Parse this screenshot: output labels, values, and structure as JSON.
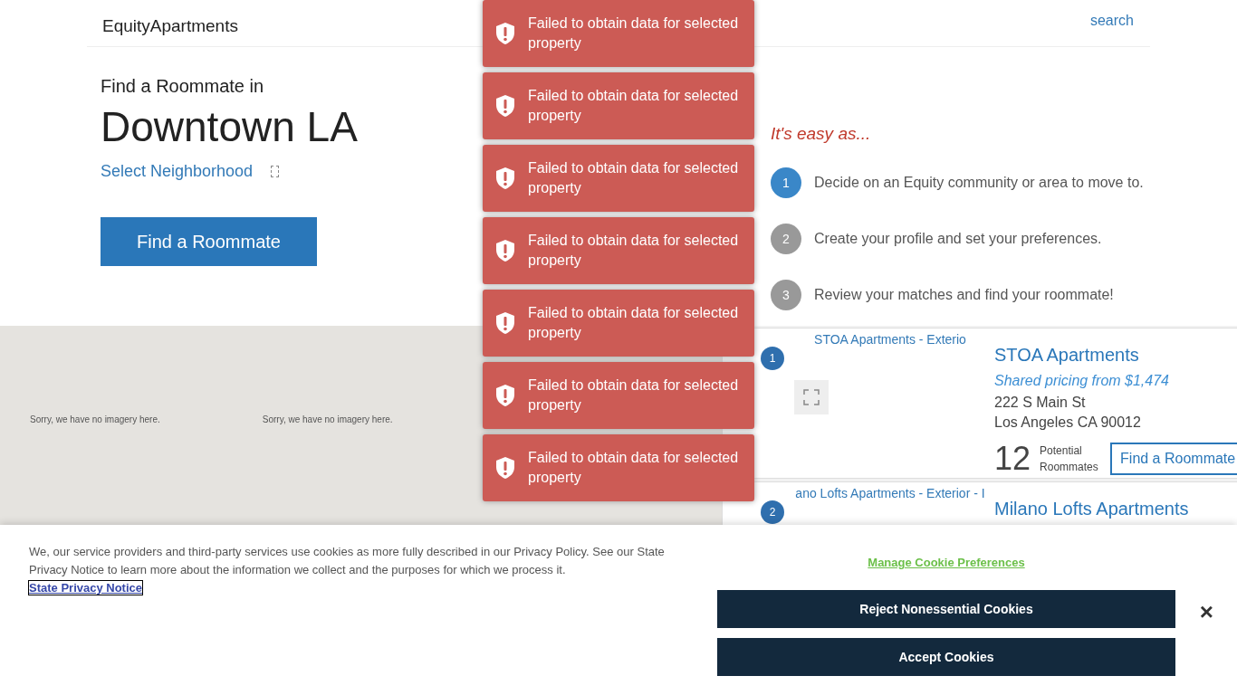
{
  "header": {
    "logo": "EquityApartments",
    "search_image_alt": "search"
  },
  "hero": {
    "intro": "Find a Roommate in",
    "city": "Downtown LA",
    "neighborhood_link": "Select Neighborhood",
    "button": "Find a Roommate"
  },
  "steps": {
    "title": "It's easy as...",
    "items": [
      {
        "number": "1",
        "text": "Decide on an Equity community or area to move to.",
        "selected": true
      },
      {
        "number": "2",
        "text": "Create your profile and set your preferences.",
        "selected": false
      },
      {
        "number": "3",
        "text": "Review your matches and find your roommate!",
        "selected": false
      }
    ]
  },
  "map": {
    "tiles": [
      "Sorry, we have no imagery here.",
      "Sorry, we have no imagery here."
    ]
  },
  "listings": [
    {
      "marker": "1",
      "image_alt": "STOA Apartments - Exterio",
      "name": "STOA Apartments",
      "pricing": "Shared pricing from $1,474",
      "address_line_1": "222 S Main St",
      "address_line_2": "Los Angeles CA 90012",
      "count": "12",
      "count_label": "Potential Roommates",
      "button": "Find a Roommate"
    },
    {
      "marker": "2",
      "image_alt": "ano Lofts Apartments - Exterior - I",
      "name": "Milano Lofts Apartments"
    }
  ],
  "toasts": [
    {
      "message": "Failed to obtain data for selected property"
    },
    {
      "message": "Failed to obtain data for selected property"
    },
    {
      "message": "Failed to obtain data for selected property"
    },
    {
      "message": "Failed to obtain data for selected property"
    },
    {
      "message": "Failed to obtain data for selected property"
    },
    {
      "message": "Failed to obtain data for selected property"
    },
    {
      "message": "Failed to obtain data for selected property"
    }
  ],
  "cookie_banner": {
    "text": "We, our service providers and third-party services use cookies as more fully described in our Privacy Policy. See our State Privacy Notice to learn more about the information we collect and the purposes for which we process it.",
    "link": "State Privacy Notice",
    "manage": "Manage Cookie Preferences",
    "reject": "Reject Nonessential Cookies",
    "accept": "Accept Cookies",
    "close": "×"
  }
}
